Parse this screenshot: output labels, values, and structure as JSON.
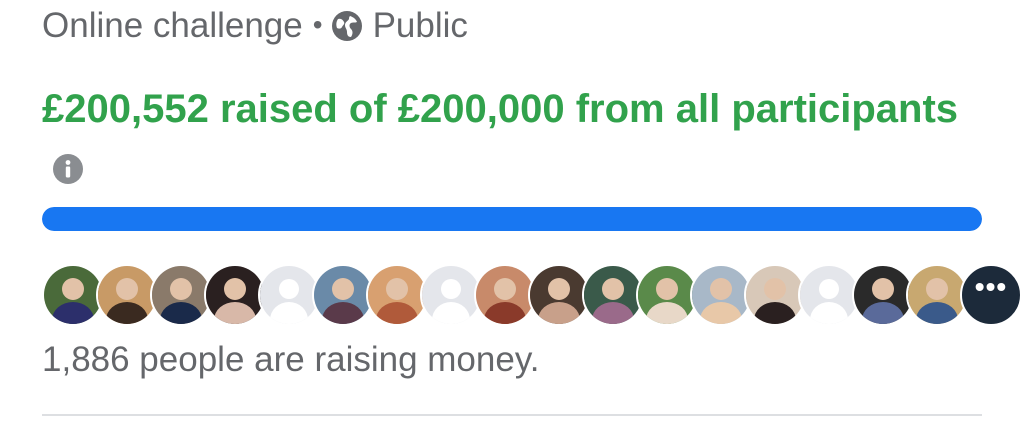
{
  "header": {
    "challenge_type": "Online challenge",
    "separator": "•",
    "privacy_icon": "globe-icon",
    "privacy_label": "Public"
  },
  "fundraiser": {
    "raised_text": "£200,552 raised of £200,000 from all participants",
    "raised_amount": "£200,552",
    "goal_amount": "£200,000",
    "info_icon": "info-icon",
    "progress_fraction": 1.0,
    "progress_color": "#1877f2",
    "accent_color": "#31a24c"
  },
  "participants": {
    "avatars": [
      {
        "kind": "photo",
        "bg": "#4a6a3a",
        "fg": "#2c2f6b"
      },
      {
        "kind": "photo",
        "bg": "#c89a66",
        "fg": "#3a2a20"
      },
      {
        "kind": "photo",
        "bg": "#8a7a6a",
        "fg": "#1a2a4a"
      },
      {
        "kind": "photo",
        "bg": "#2a2020",
        "fg": "#d8b8a8"
      },
      {
        "kind": "placeholder",
        "bg": "#e4e6eb",
        "fg": "#ffffff"
      },
      {
        "kind": "photo",
        "bg": "#6a8aa8",
        "fg": "#5a3a4a"
      },
      {
        "kind": "photo",
        "bg": "#d8a070",
        "fg": "#b05a3a"
      },
      {
        "kind": "placeholder",
        "bg": "#e4e6eb",
        "fg": "#ffffff"
      },
      {
        "kind": "photo",
        "bg": "#c88a6a",
        "fg": "#8a3a2a"
      },
      {
        "kind": "photo",
        "bg": "#4a3a30",
        "fg": "#c8a08a"
      },
      {
        "kind": "photo",
        "bg": "#3a5a4a",
        "fg": "#9a6a8a"
      },
      {
        "kind": "photo",
        "bg": "#5a8a4a",
        "fg": "#e8d8c8"
      },
      {
        "kind": "photo",
        "bg": "#a8b8c8",
        "fg": "#e8c8a8"
      },
      {
        "kind": "photo",
        "bg": "#d8c8b8",
        "fg": "#2a2020"
      },
      {
        "kind": "placeholder",
        "bg": "#e4e6eb",
        "fg": "#ffffff"
      },
      {
        "kind": "photo",
        "bg": "#2a2a2a",
        "fg": "#5a6a9a"
      },
      {
        "kind": "photo",
        "bg": "#c8a870",
        "fg": "#3a5a8a"
      }
    ],
    "more_label": "•••",
    "count_text": "1,886 people are raising money."
  }
}
